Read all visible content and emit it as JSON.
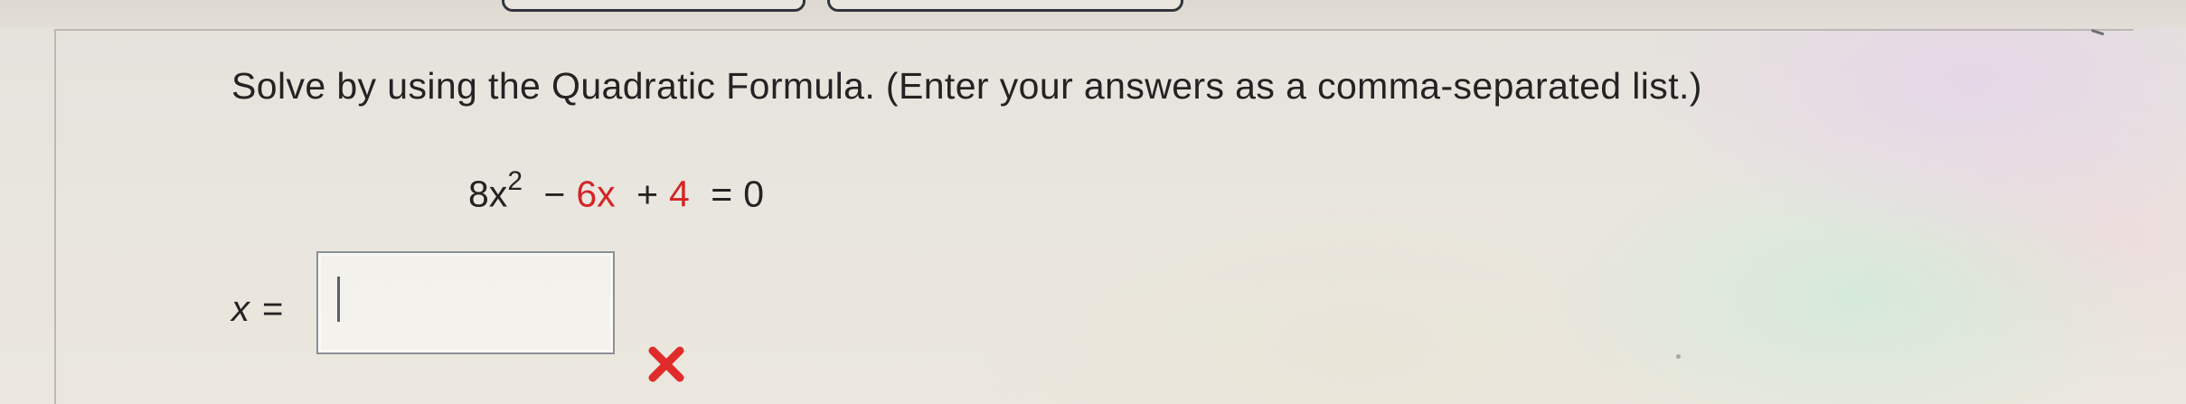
{
  "question": {
    "prompt": "Solve by using the Quadratic Formula. (Enter your answers as a comma-separated list.)",
    "equation": {
      "term1_coef": "8x",
      "term1_exp": "2",
      "op1": "−",
      "term2": "6x",
      "op2": "+",
      "term3": "4",
      "op3": "=",
      "rhs": "0"
    }
  },
  "answer": {
    "label": "x",
    "equals": "=",
    "value": ""
  },
  "feedback": {
    "status": "incorrect",
    "icon": "x-mark-icon",
    "color": "#e02b2b"
  },
  "colors": {
    "highlight": "#d42424"
  }
}
